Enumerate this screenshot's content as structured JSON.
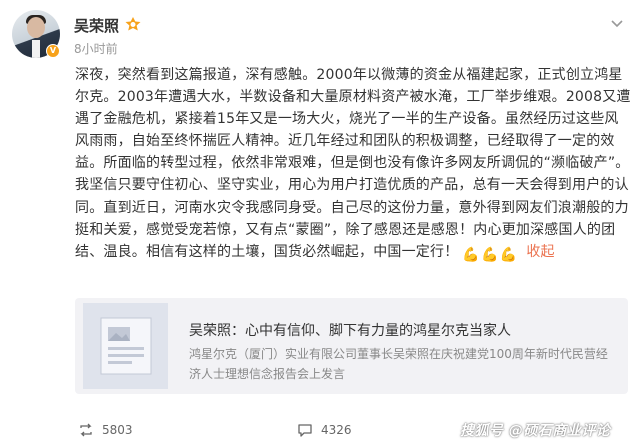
{
  "author": {
    "name": "吴荣照",
    "time": "8小时前"
  },
  "post": {
    "text": "深夜，突然看到这篇报道，深有感触。2000年以微薄的资金从福建起家，正式创立鸿星尔克。2003年遭遇大水，半数设备和大量原材料资产被水淹，工厂举步维艰。2008又遭遇了金融危机，紧接着15年又是一场大火，烧光了一半的生产设备。虽然经历过这些风风雨雨，自始至终怀揣匠人精神。近几年经过和团队的积极调整，已经取得了一定的效益。所面临的转型过程，依然非常艰难，但是倒也没有像许多网友所调侃的“濒临破产”。我坚信只要守住初心、坚守实业，用心为用户打造优质的产品，总有一天会得到用户的认同。直到近日，河南水灾令我感同身受。自己尽的这份力量，意外得到网友们浪潮般的力挺和关爱，感觉受宠若惊，又有点“蒙圈”，除了感恩还是感恩！内心更加深感国人的团结、温良。相信有这样的土壤，国货必然崛起，中国一定行！",
    "emojis": [
      "💪",
      "💪",
      "💪"
    ],
    "collapse_label": "收起"
  },
  "card": {
    "title": "吴荣照：心中有信仰、脚下有力量的鸿星尔克当家人",
    "desc": "鸿星尔克（厦门）实业有限公司董事长吴荣照在庆祝建党100周年新时代民营经济人士理想信念报告会上发言"
  },
  "actions": {
    "repost_count": "5803",
    "comment_count": "4326",
    "watermark": "搜狐号 @硕石商业评论"
  },
  "colors": {
    "accent_orange": "#eb7350",
    "vip_badge": "#f7a21b"
  }
}
